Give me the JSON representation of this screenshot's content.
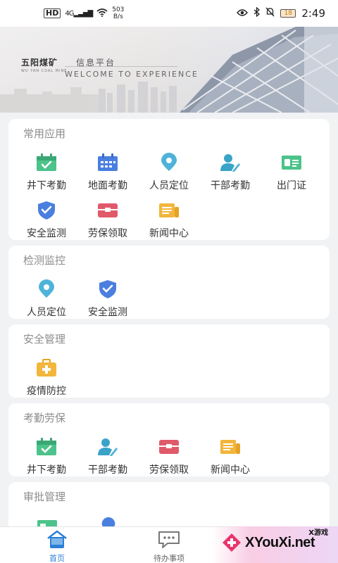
{
  "statusbar": {
    "hd": "HD",
    "signal": "4G",
    "speed": "503",
    "speed_unit": "B/s",
    "battery": "18",
    "time": "2:49"
  },
  "banner": {
    "brand": "五阳煤矿",
    "brand_sub": "WU YAN COAL MINE",
    "platform": "信息平台",
    "welcome": "WELCOME TO EXPERIENCE"
  },
  "sections": [
    {
      "title": "常用应用",
      "items": [
        {
          "label": "井下考勤",
          "icon": "calendar-check-icon"
        },
        {
          "label": "地面考勤",
          "icon": "calendar-grid-icon"
        },
        {
          "label": "人员定位",
          "icon": "location-pin-icon"
        },
        {
          "label": "干部考勤",
          "icon": "user-edit-icon"
        },
        {
          "label": "出门证",
          "icon": "id-card-icon"
        },
        {
          "label": "安全监测",
          "icon": "shield-check-icon"
        },
        {
          "label": "劳保领取",
          "icon": "box-icon"
        },
        {
          "label": "新闻中心",
          "icon": "newspaper-icon"
        }
      ]
    },
    {
      "title": "检测监控",
      "items": [
        {
          "label": "人员定位",
          "icon": "location-pin-icon"
        },
        {
          "label": "安全监测",
          "icon": "shield-check-icon"
        }
      ]
    },
    {
      "title": "安全管理",
      "items": [
        {
          "label": "疫情防控",
          "icon": "first-aid-kit-icon"
        }
      ]
    },
    {
      "title": "考勤劳保",
      "items": [
        {
          "label": "井下考勤",
          "icon": "calendar-check-icon"
        },
        {
          "label": "干部考勤",
          "icon": "user-edit-icon"
        },
        {
          "label": "劳保领取",
          "icon": "box-icon"
        },
        {
          "label": "新闻中心",
          "icon": "newspaper-icon"
        }
      ]
    },
    {
      "title": "审批管理",
      "items": []
    }
  ],
  "bottomnav": {
    "home": "首页",
    "todo": "待办事项"
  },
  "watermark": {
    "text": "XYouXi.net",
    "small": "X游戏"
  },
  "colors": {
    "green": "#4cc38a",
    "blue": "#4a7fe0",
    "teal": "#4fb3d9",
    "red": "#e05a6a",
    "yellow": "#f2b63c",
    "nav_active": "#2b7fd6"
  }
}
